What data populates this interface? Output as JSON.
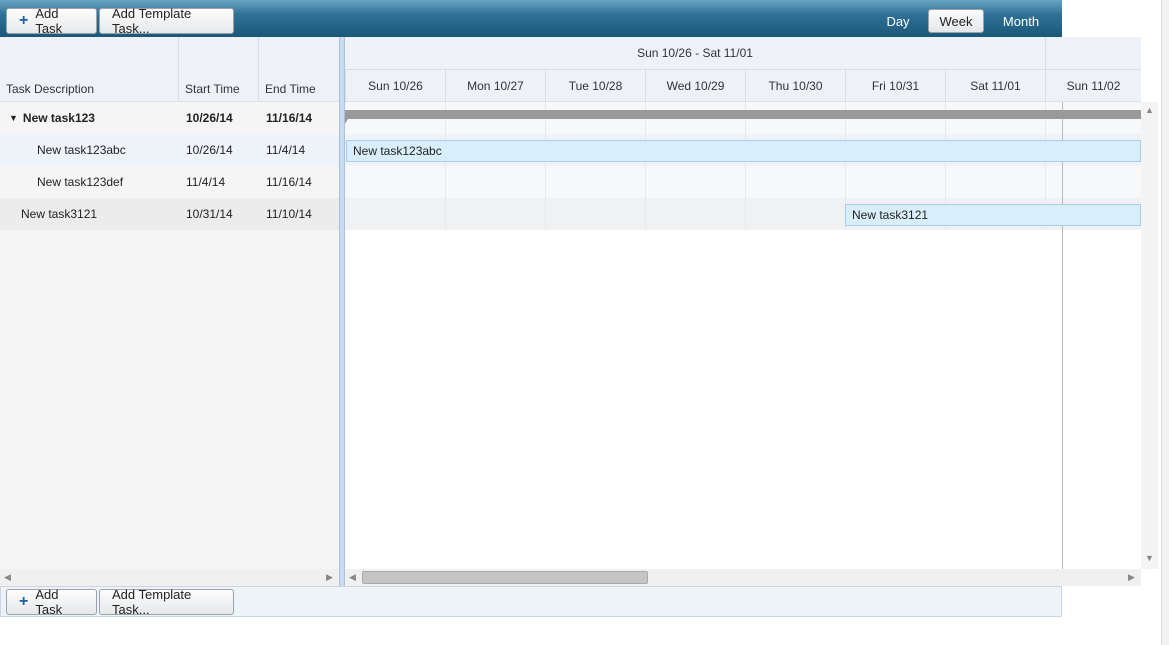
{
  "toolbar": {
    "add_task": "Add Task",
    "add_template": "Add Template Task...",
    "views": [
      "Day",
      "Week",
      "Month"
    ],
    "active_view": "Week"
  },
  "grid": {
    "columns": [
      "Task Description",
      "Start Time",
      "End Time"
    ],
    "rows": [
      {
        "name": "New task123",
        "start": "10/26/14",
        "end": "11/16/14",
        "level": 0,
        "summary": true,
        "expanded": true
      },
      {
        "name": "New task123abc",
        "start": "10/26/14",
        "end": "11/4/14",
        "level": 1,
        "summary": false
      },
      {
        "name": "New task123def",
        "start": "11/4/14",
        "end": "11/16/14",
        "level": 1,
        "summary": false
      },
      {
        "name": "New task3121",
        "start": "10/31/14",
        "end": "11/10/14",
        "level": 0,
        "summary": false
      }
    ]
  },
  "timeline": {
    "week_label": "Sun 10/26 - Sat 11/01",
    "days": [
      "Sun 10/26",
      "Mon 10/27",
      "Tue 10/28",
      "Wed 10/29",
      "Thu 10/30",
      "Fri 10/31",
      "Sat 11/01",
      "Sun 11/02"
    ],
    "bars": [
      {
        "label": "New task123abc"
      },
      {
        "label": "New task3121"
      }
    ]
  },
  "footer": {
    "add_task": "Add Task",
    "add_template": "Add Template Task..."
  },
  "colors": {
    "toolbar": "#2f7196",
    "bar_fill": "#d9eefb",
    "summary_bar": "#999999"
  }
}
